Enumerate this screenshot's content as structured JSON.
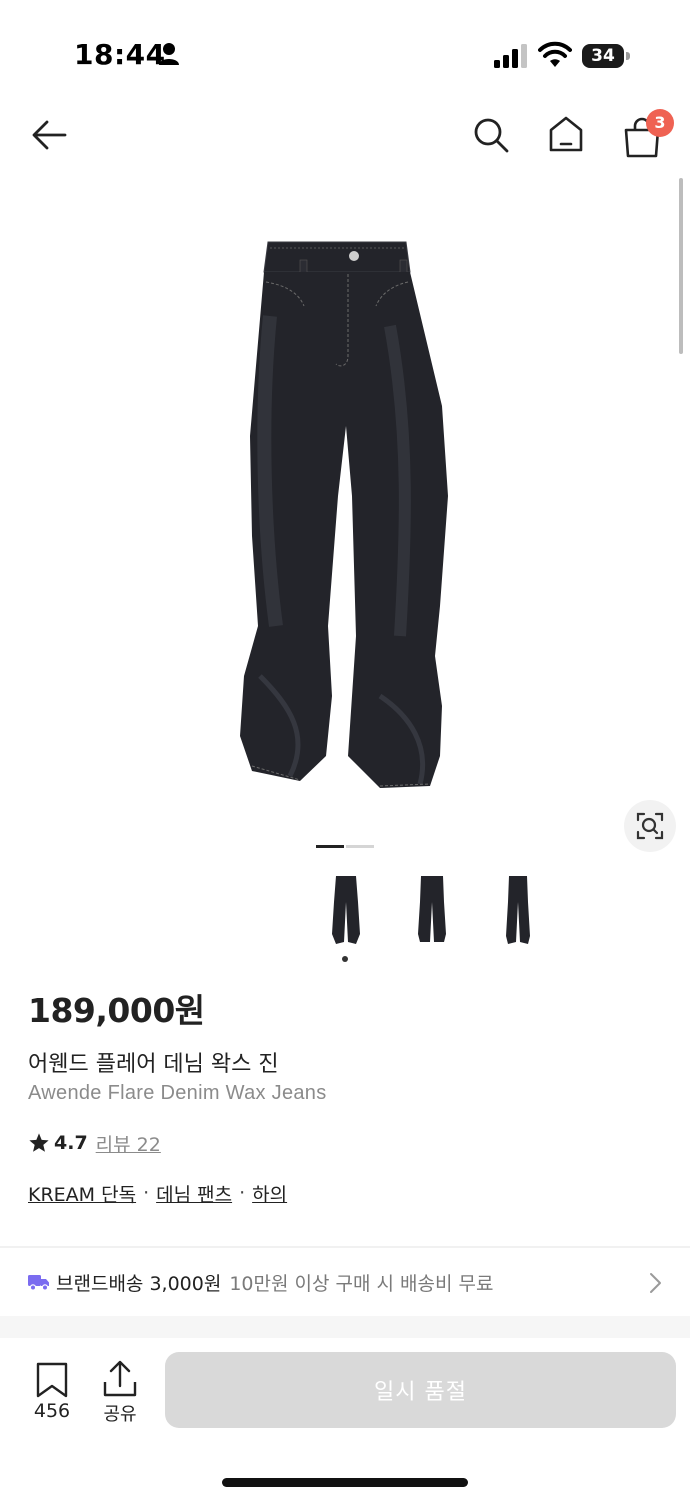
{
  "status_bar": {
    "time": "18:44",
    "battery": "34",
    "icons": [
      "person-icon",
      "signal-icon",
      "wifi-icon",
      "battery-icon"
    ]
  },
  "nav": {
    "icons": [
      "back-arrow-icon",
      "search-icon",
      "home-icon",
      "shopping-bag-icon"
    ],
    "cart_count": "3"
  },
  "gallery": {
    "total_pages": 2,
    "current_page": 1,
    "thumbnail_count": 3,
    "selected_thumbnail": 1
  },
  "product": {
    "price": "189,000원",
    "name_ko": "어웬드 플레어 데님 왁스 진",
    "name_en": "Awende Flare Denim Wax Jeans",
    "rating": "4.7",
    "review_label": "리뷰 22",
    "tags": [
      "KREAM 단독",
      "데님 팬츠",
      "하의"
    ],
    "tag_separator": "·"
  },
  "shipping": {
    "label": "브랜드배송 3,000원",
    "description": "10만원 이상 구매 시 배송비 무료"
  },
  "bottom_bar": {
    "wish_count": "456",
    "share_label": "공유",
    "action_label": "일시 품절"
  },
  "colors": {
    "badge": "#ef6253",
    "disabled_button": "#d9d9d9",
    "shipping_icon": "#7b6cf0",
    "denim": "#23242a"
  }
}
